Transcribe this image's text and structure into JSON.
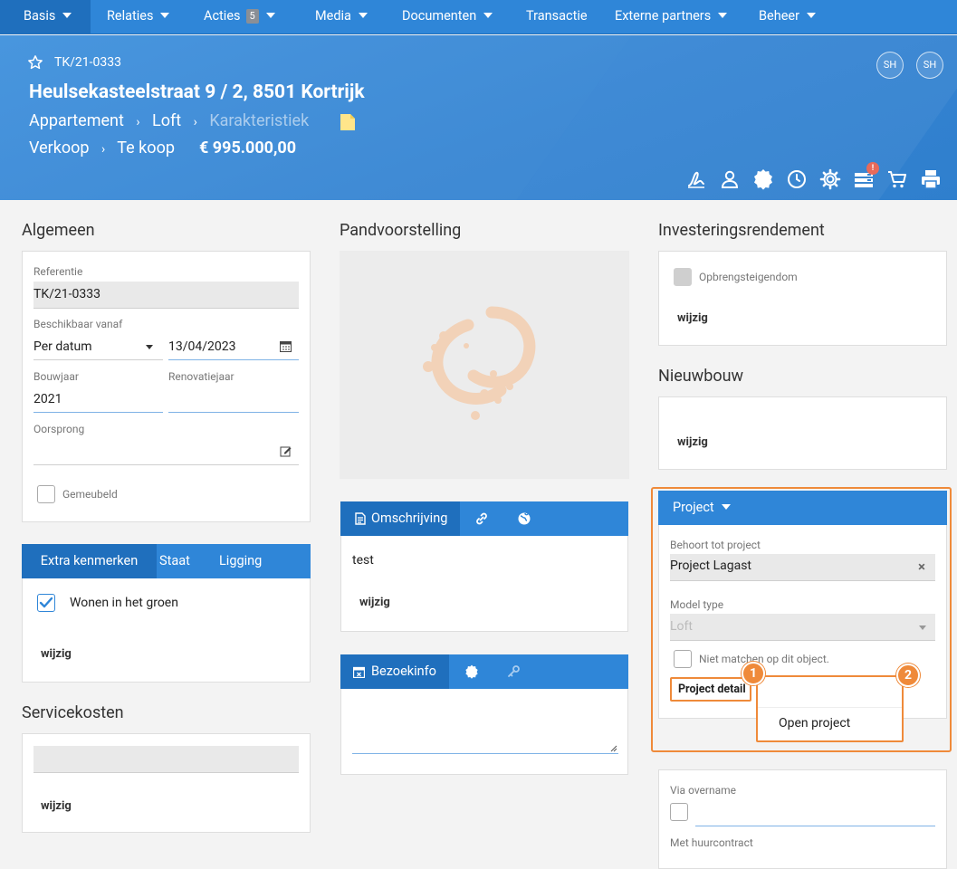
{
  "nav": {
    "items": [
      {
        "label": "Basis",
        "caret": true,
        "active": true
      },
      {
        "label": "Relaties",
        "caret": true
      },
      {
        "label": "Acties",
        "caret": true,
        "badge": "5"
      },
      {
        "label": "Media",
        "caret": true
      },
      {
        "label": "Documenten",
        "caret": true
      },
      {
        "label": "Transactie",
        "caret": false
      },
      {
        "label": "Externe partners",
        "caret": true
      },
      {
        "label": "Beheer",
        "caret": true
      }
    ]
  },
  "header": {
    "reference": "TK/21-0333",
    "address": "Heulsekasteelstraat 9  / 2, 8501 Kortrijk",
    "breadcrumb": [
      "Appartement",
      "Loft",
      "Karakteristiek"
    ],
    "status": [
      "Verkoop",
      "Te koop"
    ],
    "price": "€ 995.000,00",
    "avatars": [
      "SH",
      "SH"
    ],
    "notification_badge": "!",
    "toolbar_icons": [
      "signature-icon",
      "user-icon",
      "badge-icon",
      "clock-icon",
      "gear-icon",
      "list-icon",
      "cart-icon",
      "print-icon"
    ]
  },
  "algemeen": {
    "title": "Algemeen",
    "referentie_label": "Referentie",
    "referentie_value": "TK/21-0333",
    "beschikbaar_label": "Beschikbaar vanaf",
    "beschikbaar_select": "Per datum",
    "beschikbaar_date": "13/04/2023",
    "bouwjaar_label": "Bouwjaar",
    "bouwjaar_value": "2021",
    "renovatie_label": "Renovatiejaar",
    "oorsprong_label": "Oorsprong",
    "gemeubeld_label": "Gemeubeld"
  },
  "kenmerken": {
    "tabs": [
      "Extra kenmerken",
      "Staat",
      "Ligging"
    ],
    "item": "Wonen in het groen",
    "wijzig": "wijzig"
  },
  "servicekosten": {
    "title": "Servicekosten",
    "wijzig": "wijzig"
  },
  "pand": {
    "title": "Pandvoorstelling"
  },
  "omschrijving": {
    "tab": "Omschrijving",
    "text": "test",
    "wijzig": "wijzig"
  },
  "bezoek": {
    "tab": "Bezoekinfo"
  },
  "investering": {
    "title": "Investeringsrendement",
    "checkbox_label": "Opbrengsteigendom",
    "wijzig": "wijzig"
  },
  "nieuwbouw": {
    "title": "Nieuwbouw",
    "wijzig": "wijzig"
  },
  "project": {
    "header": "Project",
    "behoort_label": "Behoort tot project",
    "behoort_value": "Project Lagast",
    "model_label": "Model type",
    "model_value": "Loft",
    "niet_matchen": "Niet matchen op dit object.",
    "detail_button": "Project detail",
    "menu_item": "Open project",
    "marker1": "1",
    "marker2": "2"
  },
  "overname": {
    "via_label": "Via overname",
    "huur_label": "Met huurcontract"
  },
  "colors": {
    "primary": "#2f86d8",
    "primary_dark": "#1f6fbd",
    "highlight": "#ef8a3a",
    "logo": "#f2c9a8"
  }
}
